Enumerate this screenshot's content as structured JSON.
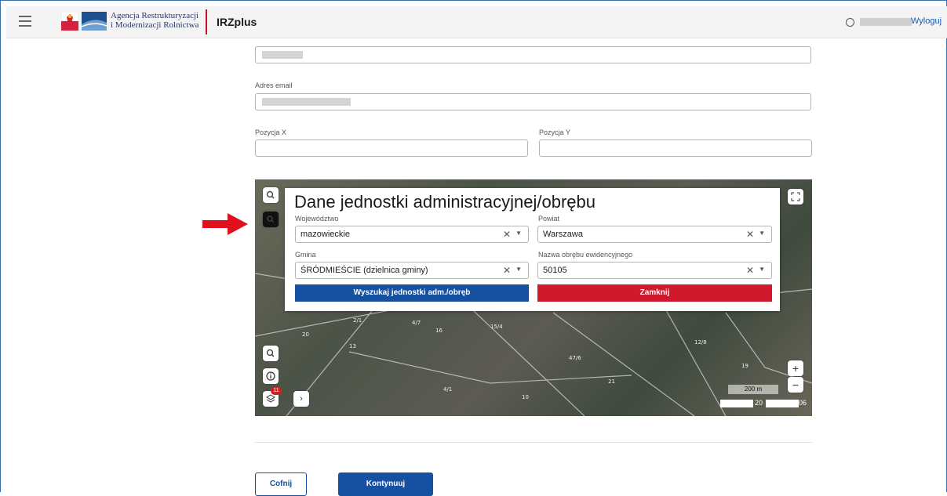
{
  "header": {
    "agency_line1": "Agencja Restrukturyzacji",
    "agency_line2": "i Modernizacji Rolnictwa",
    "app_name": "IRZplus",
    "logout": "Wyloguj"
  },
  "form": {
    "email_label": "Adres email",
    "pos_x_label": "Pozycja X",
    "pos_y_label": "Pozycja Y",
    "pos_x_value": "",
    "pos_y_value": ""
  },
  "dialog": {
    "title": "Dane jednostki administracyjnej/obrębu",
    "voivodeship_label": "Województwo",
    "voivodeship_value": "mazowieckie",
    "county_label": "Powiat",
    "county_value": "Warszawa",
    "commune_label": "Gmina",
    "commune_value": "ŚRÓDMIEŚCIE (dzielnica gminy)",
    "precinct_label": "Nazwa obrębu ewidencyjnego",
    "precinct_value": "50105",
    "search_button": "Wyszukaj jednostki adm./obręb",
    "close_button": "Zamknij"
  },
  "map": {
    "layers_badge": "11",
    "scale_text": "200 m",
    "coord_fragment_1": "20",
    "coord_fragment_2": "06",
    "zoom_in": "+",
    "zoom_out": "−",
    "expand_sidebar": "›"
  },
  "actions": {
    "back": "Cofnij",
    "continue": "Kontynuuj"
  },
  "colors": {
    "primary": "#1650a0",
    "danger": "#d0192c",
    "arrow": "#e0101c"
  }
}
